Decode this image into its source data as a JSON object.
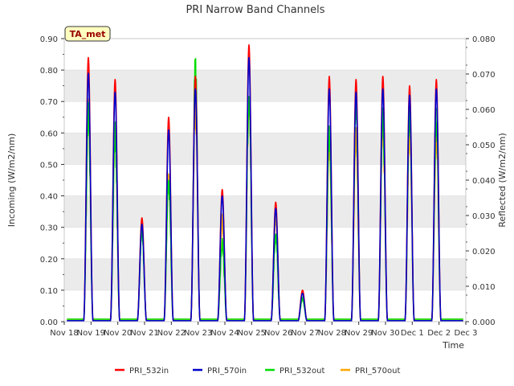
{
  "chart_data": {
    "type": "line",
    "title": "PRI Narrow Band Channels",
    "xlabel": "Time",
    "ylabel_left": "Incoming (W/m2/nm)",
    "ylabel_right": "Reflected (W/m2/nm)",
    "badge": "TA_met",
    "ylim_left": [
      0,
      0.9
    ],
    "ylim_right": [
      0,
      0.08
    ],
    "yticks_left": [
      "0.00",
      "0.10",
      "0.20",
      "0.30",
      "0.40",
      "0.50",
      "0.60",
      "0.70",
      "0.80",
      "0.90"
    ],
    "yticks_right": [
      "0.000",
      "0.010",
      "0.020",
      "0.030",
      "0.040",
      "0.050",
      "0.060",
      "0.070",
      "0.080"
    ],
    "xlim": [
      0,
      15
    ],
    "xticks": [
      "Nov 18",
      "Nov 19",
      "Nov 20",
      "Nov 21",
      "Nov 22",
      "Nov 23",
      "Nov 24",
      "Nov 25",
      "Nov 26",
      "Nov 27",
      "Nov 28",
      "Nov 29",
      "Nov 30",
      "Dec 1",
      "Dec 2",
      "Dec 3"
    ],
    "grid": "horizontal bands",
    "legend_position": "bottom",
    "daily_peaks": {
      "days": [
        "Nov 18",
        "Nov 19",
        "Nov 20",
        "Nov 21",
        "Nov 22",
        "Nov 23",
        "Nov 24",
        "Nov 25",
        "Nov 26",
        "Nov 27",
        "Nov 28",
        "Nov 29",
        "Nov 30",
        "Dec 1",
        "Dec 2"
      ],
      "series": [
        {
          "name": "PRI_532in",
          "axis": "left",
          "color": "#ff0000",
          "values": [
            0.84,
            0.77,
            0.33,
            0.65,
            0.78,
            0.42,
            0.88,
            0.38,
            0.1,
            0.78,
            0.77,
            0.78,
            0.75,
            0.77
          ]
        },
        {
          "name": "PRI_570in",
          "axis": "left",
          "color": "#0000cc",
          "values": [
            0.79,
            0.73,
            0.31,
            0.61,
            0.74,
            0.4,
            0.84,
            0.36,
            0.09,
            0.74,
            0.73,
            0.74,
            0.72,
            0.74
          ]
        },
        {
          "name": "PRI_532out",
          "axis": "right",
          "color": "#00dd00",
          "values": [
            0.063,
            0.057,
            0.027,
            0.043,
            0.077,
            0.024,
            0.069,
            0.026,
            0.007,
            0.058,
            0.067,
            0.062,
            0.063,
            0.063
          ]
        },
        {
          "name": "PRI_570out",
          "axis": "right",
          "color": "#ffa500",
          "values": [
            0.064,
            0.057,
            0.03,
            0.045,
            0.065,
            0.031,
            0.068,
            0.032,
            0.009,
            0.055,
            0.056,
            0.059,
            0.057,
            0.057
          ]
        }
      ]
    }
  }
}
